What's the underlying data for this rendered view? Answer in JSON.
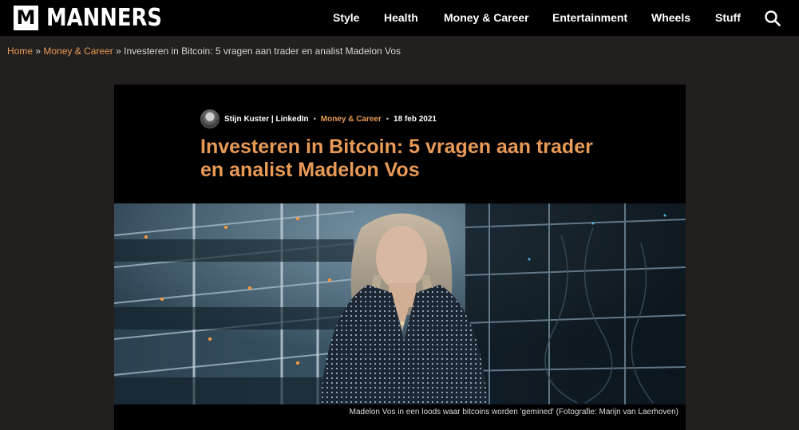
{
  "brand": {
    "logo_letter": "M",
    "name": "MANNERS"
  },
  "nav": {
    "items": [
      {
        "label": "Style"
      },
      {
        "label": "Health"
      },
      {
        "label": "Money & Career"
      },
      {
        "label": "Entertainment"
      },
      {
        "label": "Wheels"
      },
      {
        "label": "Stuff"
      }
    ],
    "search_icon": "search-icon"
  },
  "breadcrumb": {
    "home": "Home",
    "separator": "»",
    "category": "Money & Career",
    "current": "Investeren in Bitcoin: 5 vragen aan trader en analist Madelon Vos"
  },
  "article": {
    "author": "Stijn Kuster | LinkedIn",
    "category": "Money & Career",
    "date": "18 feb 2021",
    "separator": "•",
    "title": "Investeren in Bitcoin: 5 vragen aan trader en analist Madelon Vos",
    "image_caption": "Madelon Vos in een loods waar bitcoins worden 'gemined'  (Fotografie: Marijn van Laerhoven)"
  },
  "colors": {
    "page_bg": "#221f1e",
    "bar_bg": "#000000",
    "accent": "#e89a57",
    "text": "#ffffff"
  }
}
